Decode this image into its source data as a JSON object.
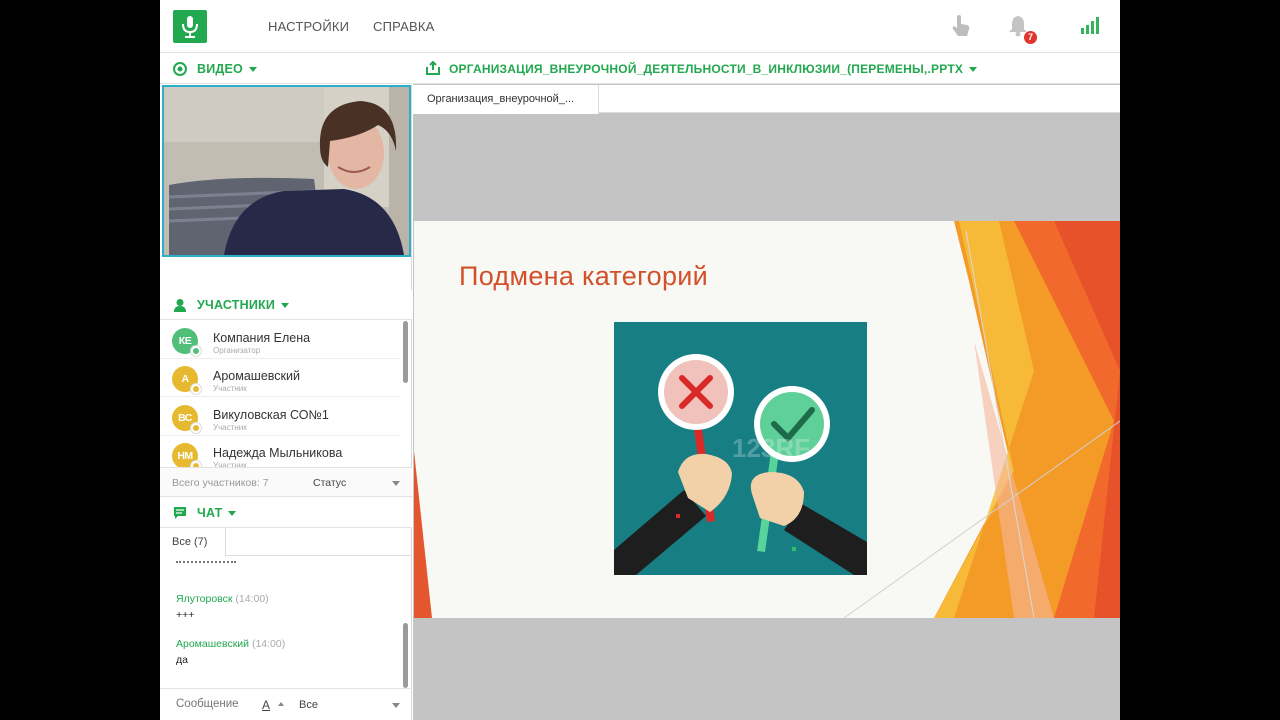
{
  "topbar": {
    "nav": [
      "НАСТРОЙКИ",
      "СПРАВКА"
    ],
    "notifications_count": "7",
    "icons": [
      "microphone-logo-icon",
      "raise-hand-icon",
      "bell-icon",
      "signal-strength-icon"
    ]
  },
  "video": {
    "title": "ВИДЕО"
  },
  "participants": {
    "title": "УЧАСТНИКИ",
    "items": [
      {
        "initials": "КЕ",
        "name": "Компания Елена",
        "role": "Организатор",
        "color": "#4fbf7a"
      },
      {
        "initials": "А",
        "name": "Аромашевский",
        "role": "Участник",
        "color": "#e6b930"
      },
      {
        "initials": "ВС",
        "name": "Викуловская СО№1",
        "role": "Участник",
        "color": "#e6b930"
      },
      {
        "initials": "НМ",
        "name": "Надежда Мыльникова",
        "role": "Участник",
        "color": "#e6b930"
      }
    ],
    "total_label": "Всего участников: 7",
    "status_label": "Статус"
  },
  "chat": {
    "title": "ЧАТ",
    "tab": "Все (7)",
    "messages": [
      {
        "author": "Ялуторовск",
        "time": "(14:00)",
        "text": "+++"
      },
      {
        "author": "Аромашевский",
        "time": "(14:00)",
        "text": "да"
      }
    ],
    "input_placeholder": "Сообщение",
    "font_label": "A",
    "recipient": "Все"
  },
  "document": {
    "title": "ОРГАНИЗАЦИЯ_ВНЕУРОЧНОЙ_ДЕЯТЕЛЬНОСТИ_В_ИНКЛЮЗИИ_(ПЕРЕМЕНЫ,.PPTX",
    "tab": "Организация_внеурочной_..."
  },
  "slide": {
    "title": "Подмена категорий",
    "watermark": "123RF"
  },
  "colors": {
    "accent": "#22a84f",
    "video_border": "#2bb0c9",
    "slide_title": "#d2502a",
    "badge": "#e0342c"
  }
}
